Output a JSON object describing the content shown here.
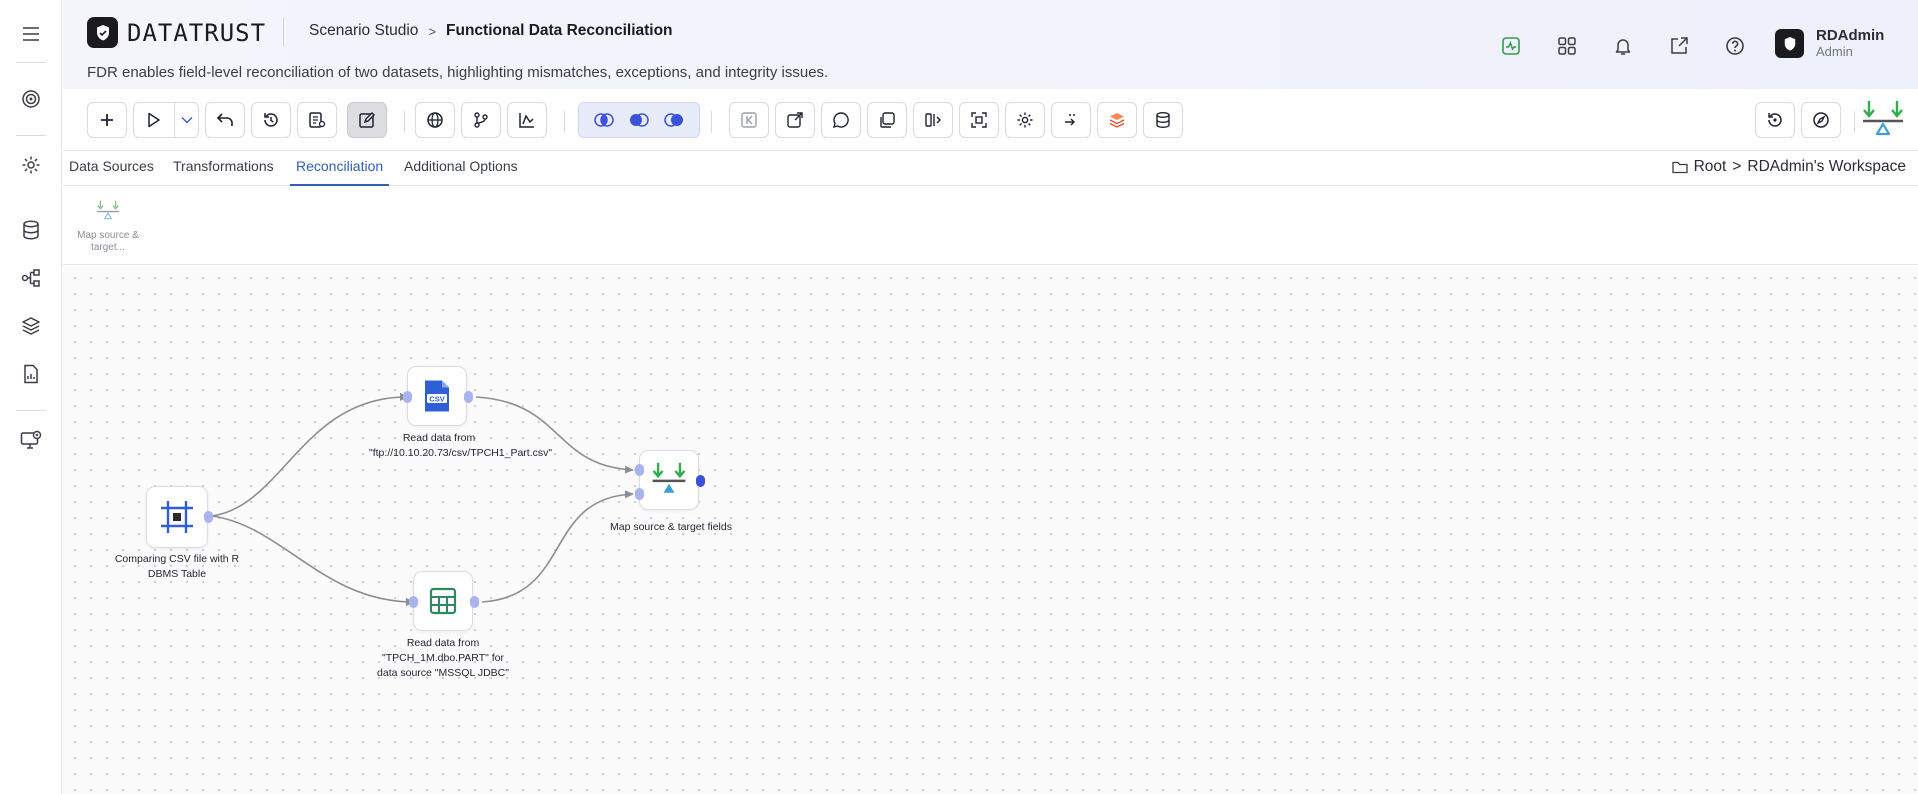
{
  "app": {
    "logo_text_bold": "DATA",
    "logo_text_light": "TRUST",
    "breadcrumb_studio": "Scenario Studio",
    "breadcrumb_sep": ">",
    "breadcrumb_current": "Functional Data Reconciliation",
    "description": "FDR enables field-level reconciliation of two datasets, highlighting mismatches, exceptions, and integrity issues."
  },
  "header_icons": [
    "activity-icon",
    "apps-grid-icon",
    "bell-icon",
    "external-link-icon",
    "help-icon"
  ],
  "user": {
    "name": "RDAdmin",
    "role": "Admin"
  },
  "sidebar": [
    "menu-icon",
    "target-icon",
    "gear-icon",
    "database-icon",
    "workflow-icon",
    "layers-icon",
    "report-icon",
    "monitor-icon"
  ],
  "tabs": [
    {
      "label": "Data Sources",
      "active": false
    },
    {
      "label": "Transformations",
      "active": false
    },
    {
      "label": "Reconciliation",
      "active": true
    },
    {
      "label": "Additional Options",
      "active": false
    }
  ],
  "workspace": {
    "root": "Root",
    "sep": ">",
    "name": "RDAdmin's Workspace"
  },
  "palette": {
    "item_label": "Map source & target..."
  },
  "nodes": {
    "start": {
      "label": "Comparing CSV file with R DBMS Table"
    },
    "csv": {
      "label": "Read data from \"ftp://10.10.20.73/csv/TPCH1_Part.csv\"",
      "badge": "CSV"
    },
    "db": {
      "label": "Read data from \"TPCH_1M.dbo.PART\" for data source \"MSSQL JDBC\""
    },
    "map": {
      "label": "Map source & target fields"
    }
  },
  "colors": {
    "accent": "#2f5fb7",
    "node_blue": "#2f5fd6",
    "grid_green": "#2e8a5e",
    "arrow_green": "#2fae4b",
    "tri_blue": "#3aa0d6"
  }
}
